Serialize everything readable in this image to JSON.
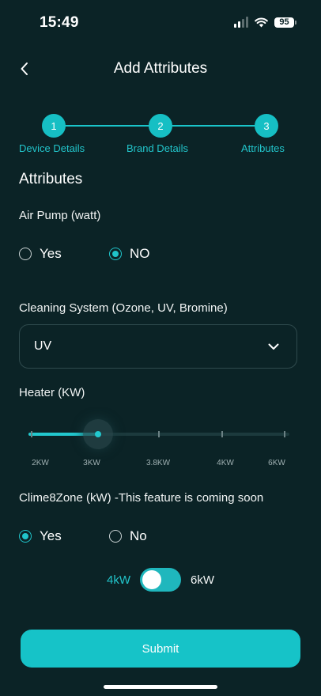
{
  "status_bar": {
    "time": "15:49",
    "battery": "95"
  },
  "header": {
    "title": "Add Attributes"
  },
  "stepper": {
    "steps": [
      {
        "number": "1",
        "label": "Device Details"
      },
      {
        "number": "2",
        "label": "Brand Details"
      },
      {
        "number": "3",
        "label": "Attributes"
      }
    ]
  },
  "section_title": "Attributes",
  "air_pump": {
    "label": "Air Pump (watt)",
    "options": [
      "Yes",
      "NO"
    ],
    "selected": "NO"
  },
  "cleaning_system": {
    "label": "Cleaning System (Ozone, UV, Bromine)",
    "value": "UV"
  },
  "heater": {
    "label": "Heater (KW)",
    "ticks": [
      "2KW",
      "3KW",
      "3.8KW",
      "4KW",
      "6KW"
    ],
    "selected": "3KW"
  },
  "clime8zone": {
    "label": "Clime8Zone (kW) -This feature is coming soon",
    "options": [
      "Yes",
      "No"
    ],
    "selected": "Yes",
    "toggle_left": "4kW",
    "toggle_right": "6kW"
  },
  "submit_label": "Submit",
  "colors": {
    "background": "#0b2326",
    "accent": "#16c3c8"
  }
}
